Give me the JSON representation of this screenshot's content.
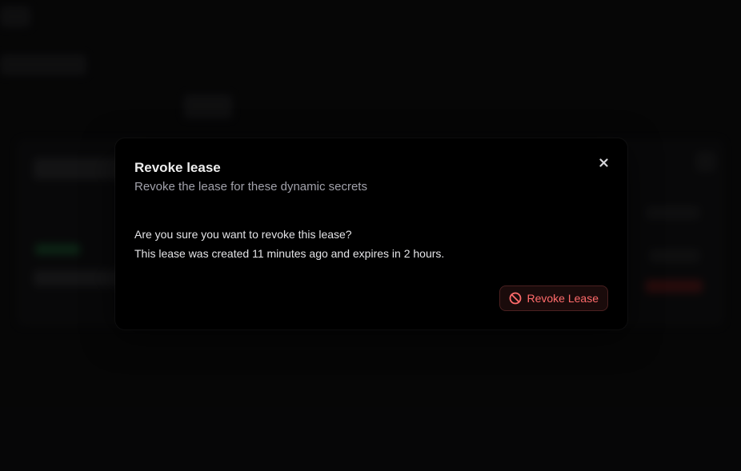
{
  "dialog": {
    "title": "Revoke lease",
    "subtitle": "Revoke the lease for these dynamic secrets",
    "message_line1": "Are you sure you want to revoke this lease?",
    "message_line2": "This lease was created 11 minutes ago and expires in 2 hours.",
    "close_icon": "close-icon",
    "confirm_label": "Revoke Lease",
    "confirm_icon": "ban-icon",
    "colors": {
      "danger": "#ff6b6b",
      "modal_bg": "#000000",
      "backdrop": "#0b0b0c"
    }
  }
}
